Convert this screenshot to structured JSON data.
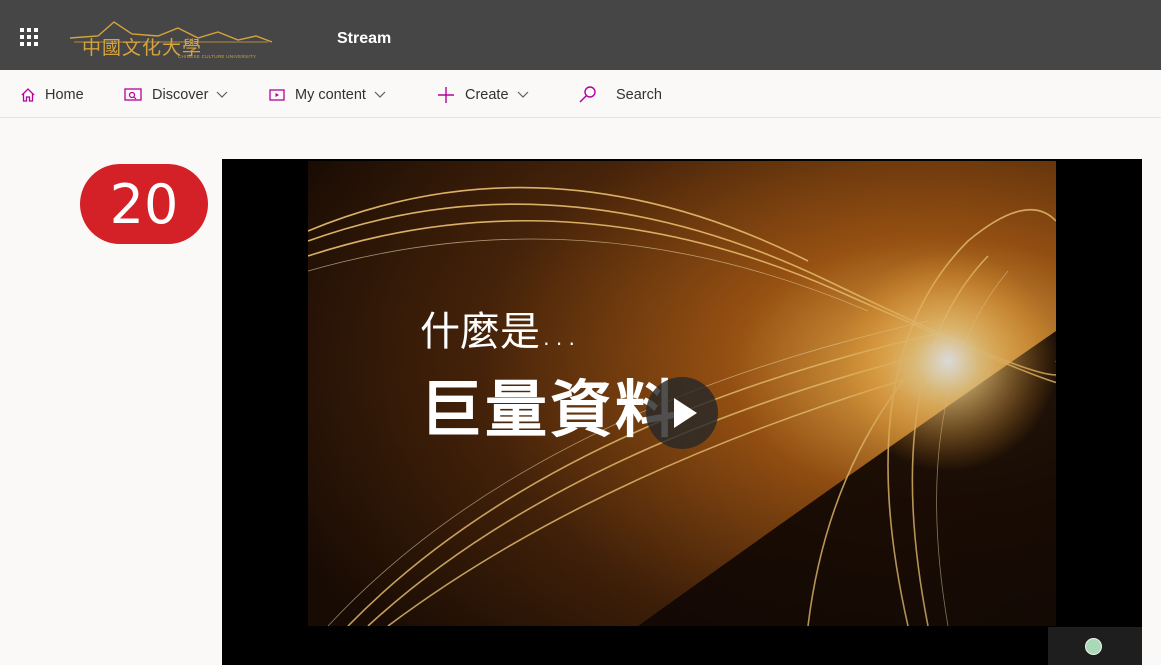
{
  "header": {
    "app_title": "Stream",
    "logo_name": "中國文化大學",
    "logo_subtitle": "CHINESE CULTURE UNIVERSITY",
    "bg_color": "#464646",
    "logo_color": "#d6a33c"
  },
  "nav": {
    "items": [
      {
        "label": "Home",
        "icon": "home-icon"
      },
      {
        "label": "Discover",
        "icon": "discover-icon",
        "dropdown": true
      },
      {
        "label": "My content",
        "icon": "my-content-icon",
        "dropdown": true
      },
      {
        "label": "Create",
        "icon": "plus-icon",
        "dropdown": true
      },
      {
        "label": "Search",
        "icon": "search-icon"
      }
    ],
    "accent_color": "#b4009e"
  },
  "badge": {
    "number": "20",
    "color": "#d42027"
  },
  "video": {
    "slide_line1": "什麼是...",
    "slide_line2": "巨量資料",
    "play_icon": "play-icon"
  }
}
